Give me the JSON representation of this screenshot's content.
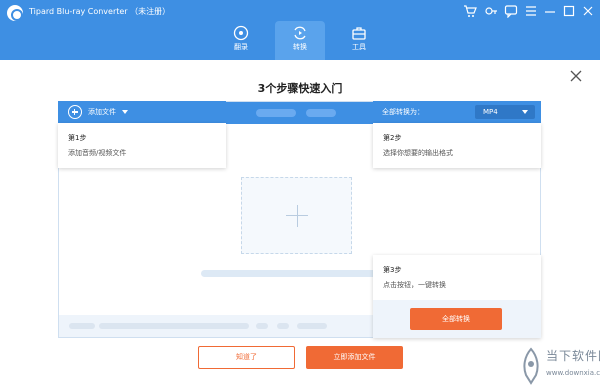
{
  "app": {
    "title": "Tipard Blu-ray Converter （未注册）"
  },
  "titlebar_icons": [
    "cart-icon",
    "key-icon",
    "chat-icon",
    "menu-icon",
    "minimize-icon",
    "maximize-icon",
    "close-icon"
  ],
  "nav": {
    "tabs": [
      {
        "label": "翻录",
        "icon": "disc-icon"
      },
      {
        "label": "转换",
        "icon": "convert-icon",
        "active": true
      },
      {
        "label": "工具",
        "icon": "toolbox-icon"
      }
    ]
  },
  "guide": {
    "heading": "3个步骤快速入门",
    "add_files_label": "添加文件",
    "convert_all_label": "全部转换为：",
    "format_value": "MP4",
    "steps": [
      {
        "title": "第1步",
        "desc": "添加音频/视频文件"
      },
      {
        "title": "第2步",
        "desc": "选择你想要的输出格式"
      },
      {
        "title": "第3步",
        "desc": "点击按钮，一键转换"
      }
    ],
    "convert_button": "全部转换",
    "got_it_button": "知道了",
    "add_now_button": "立即添加文件"
  },
  "watermark": {
    "text_cn": "当下软件园",
    "url": "www.downxia.com"
  },
  "colors": {
    "brand_blue": "#3e8fe3",
    "accent_orange": "#f06a35"
  }
}
